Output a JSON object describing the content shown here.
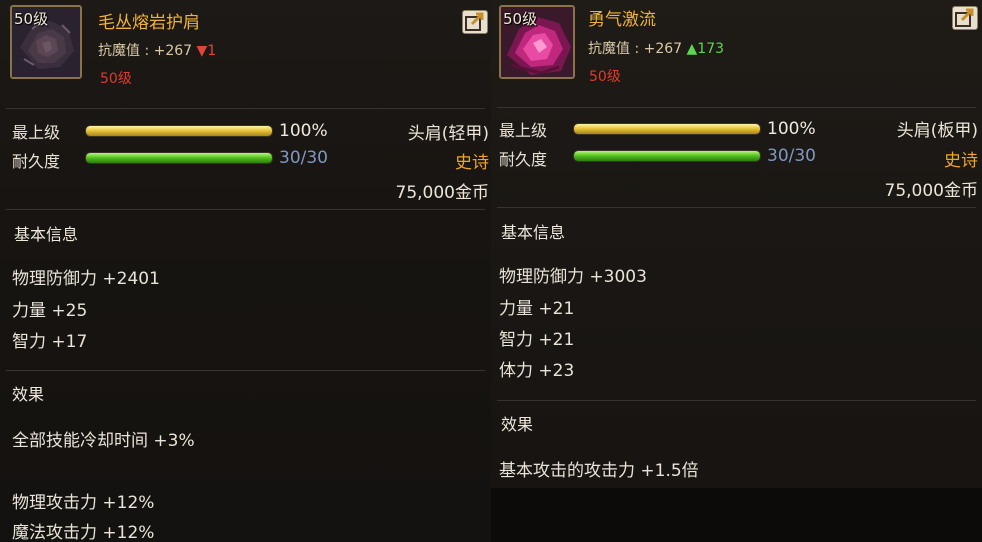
{
  "left": {
    "level_badge": "50级",
    "name": "毛丛熔岩护肩",
    "resist_label": "抗魔值 : +267",
    "resist_diff": "▼1",
    "req_level": "50级",
    "max_level_label": "最上级",
    "max_level_value": "100%",
    "max_level_progress": 1.0,
    "durability_label": "耐久度",
    "durability_value": "30/30",
    "durability_progress": 1.0,
    "slot_type": "头肩(轻甲)",
    "rarity": "史诗",
    "price": "75,000金币",
    "basic_info_title": "基本信息",
    "basic_stats": [
      "物理防御力 +2401",
      "力量 +25",
      "智力 +17"
    ],
    "effect_title": "效果",
    "effects": [
      "全部技能冷却时间 +3%",
      "物理攻击力 +12%",
      "魔法攻击力 +12%"
    ]
  },
  "right": {
    "level_badge": "50级",
    "name": "勇气激流",
    "resist_label": "抗魔值 : +267",
    "resist_diff": "▲173",
    "req_level": "50级",
    "max_level_label": "最上级",
    "max_level_value": "100%",
    "max_level_progress": 1.0,
    "durability_label": "耐久度",
    "durability_value": "30/30",
    "durability_progress": 1.0,
    "slot_type": "头肩(板甲)",
    "rarity": "史诗",
    "price": "75,000金币",
    "basic_info_title": "基本信息",
    "basic_stats": [
      "物理防御力 +3003",
      "力量 +21",
      "智力 +21",
      "体力 +23"
    ],
    "effect_title": "效果",
    "effects": [
      "基本攻击的攻击力 +1.5倍"
    ]
  },
  "icons": {
    "share": "share-external-icon",
    "left_item": "lava-shoulder-armor-icon",
    "right_item": "magenta-crystal-shoulder-icon"
  },
  "colors": {
    "name": "#f2b23a",
    "epic": "#f2a524",
    "req_level": "#e03a2e",
    "diff_down": "#e0443a",
    "diff_up": "#5cd64e",
    "durability": "#7f98c2"
  }
}
